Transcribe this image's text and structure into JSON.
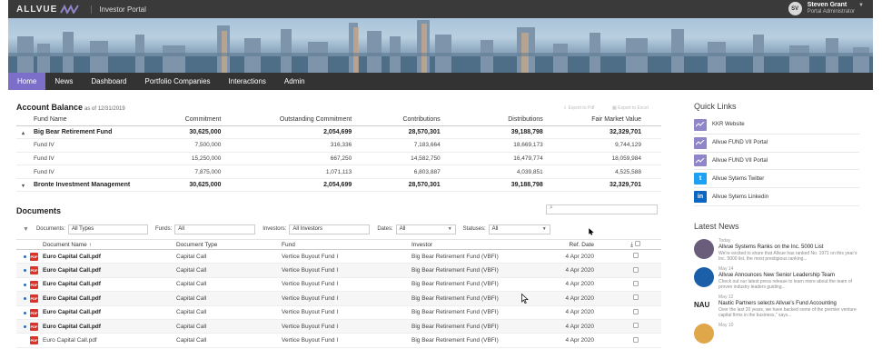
{
  "header": {
    "logo": "ALLVUE",
    "portal_title": "Investor Portal",
    "user_initials": "SV",
    "user_name": "Steven Grant",
    "user_role": "Portal Administrator"
  },
  "nav": [
    "Home",
    "News",
    "Dashboard",
    "Portfolio Companies",
    "Interactions",
    "Admin"
  ],
  "account_balance": {
    "title": "Account Balance",
    "as_of": "as of 12/31/2019",
    "export_pdf": "Export to Pdf",
    "export_excel": "Export to Excel",
    "columns": [
      "Fund Name",
      "Commitment",
      "Outstanding Commitment",
      "Contributions",
      "Distributions",
      "Fair Market Value"
    ],
    "rows": [
      {
        "type": "parent",
        "expander": "▴",
        "cells": [
          "Big Bear Retirement Fund",
          "30,625,000",
          "2,054,699",
          "28,570,301",
          "39,188,798",
          "32,329,701"
        ]
      },
      {
        "type": "child",
        "cells": [
          "Fund IV",
          "7,500,000",
          "316,336",
          "7,183,664",
          "18,669,173",
          "9,744,129"
        ]
      },
      {
        "type": "child",
        "cells": [
          "Fund IV",
          "15,250,000",
          "667,250",
          "14,582,750",
          "16,479,774",
          "18,059,984"
        ]
      },
      {
        "type": "child",
        "cells": [
          "Fund IV",
          "7,875,000",
          "1,071,113",
          "6,803,887",
          "4,039,851",
          "4,525,588"
        ]
      },
      {
        "type": "parent",
        "expander": "▾",
        "cells": [
          "Bronte Investment Management",
          "30,625,000",
          "2,054,699",
          "28,570,301",
          "39,188,798",
          "32,329,701"
        ]
      }
    ]
  },
  "documents": {
    "title": "Documents",
    "filters": {
      "documents_label": "Documents:",
      "documents_value": "All Types",
      "funds_label": "Funds:",
      "funds_value": "All",
      "investors_label": "Investors:",
      "investors_value": "All Investors",
      "dates_label": "Dates:",
      "dates_value": "All",
      "statuses_label": "Statuses:",
      "statuses_value": "All"
    },
    "columns": [
      "Document Name ↑",
      "Document Type",
      "Fund",
      "Investor",
      "Ref. Date"
    ],
    "rows": [
      {
        "unread": true,
        "cells": [
          "Euro Capital Call.pdf",
          "Capital Call",
          "Vertice Buyout Fund I",
          "Big Bear Retirement Fund (VBFI)",
          "4 Apr 2020"
        ]
      },
      {
        "unread": true,
        "cells": [
          "Euro Capital Call.pdf",
          "Capital Call",
          "Vertice Buyout Fund I",
          "Big Bear Retirement Fund (VBFI)",
          "4 Apr 2020"
        ]
      },
      {
        "unread": true,
        "cells": [
          "Euro Capital Call.pdf",
          "Capital Call",
          "Vertice Buyout Fund I",
          "Big Bear Retirement Fund (VBFI)",
          "4 Apr 2020"
        ]
      },
      {
        "unread": true,
        "cells": [
          "Euro Capital Call.pdf",
          "Capital Call",
          "Vertice Buyout Fund I",
          "Big Bear Retirement Fund (VBFI)",
          "4 Apr 2020"
        ]
      },
      {
        "unread": true,
        "cells": [
          "Euro Capital Call.pdf",
          "Capital Call",
          "Vertice Buyout Fund I",
          "Big Bear Retirement Fund (VBFI)",
          "4 Apr 2020"
        ]
      },
      {
        "unread": true,
        "cells": [
          "Euro Capital Call.pdf",
          "Capital Call",
          "Vertice Buyout Fund I",
          "Big Bear Retirement Fund (VBFI)",
          "4 Apr 2020"
        ]
      },
      {
        "unread": false,
        "cells": [
          "Euro Capital Call.pdf",
          "Capital Call",
          "Vertice Buyout Fund I",
          "Big Bear Retirement Fund (VBFI)",
          "4 Apr 2020"
        ]
      }
    ]
  },
  "quick_links": {
    "title": "Quick Links",
    "items": [
      {
        "label": "KKR Website",
        "icon": "chart-link-icon",
        "color": "#8e86c9"
      },
      {
        "label": "Allvue FUND VII Portal",
        "icon": "chart-link-icon",
        "color": "#8e86c9"
      },
      {
        "label": "Allvue FUND VII Portal",
        "icon": "chart-link-icon",
        "color": "#8e86c9"
      },
      {
        "label": "Allvue Sytems Twitter",
        "icon": "twitter-icon",
        "color": "#1da1f2"
      },
      {
        "label": "Allvue Sytems Linkedin",
        "icon": "linkedin-icon",
        "color": "#0a66c2"
      }
    ]
  },
  "latest_news": {
    "title": "Latest News",
    "items": [
      {
        "date": "Today",
        "title": "Allvue Systems Ranks on the Inc. 5000 List",
        "body": "We're excited to share that Allvue has ranked No. 1971 on this year's Inc. 5000 list, the most prestigious ranking..."
      },
      {
        "date": "May 14",
        "title": "Allvue Announces New Senior Leadership Team",
        "body": "Check out our latest press release to learn more about the team of proven industry leaders guiding..."
      },
      {
        "date": "May 12",
        "title": "Nautic Partners selects Allvue's Fund Accounting",
        "body": "Over the last 20 years, we have backed some of the premier venture capital firms in the business,\" says..."
      },
      {
        "date": "May 10",
        "title": "",
        "body": ""
      }
    ]
  },
  "colors": {
    "nav_active": "#7b6fc9",
    "topbar": "#3a3a3a",
    "nav": "#333333",
    "pdf": "#d9342b",
    "unread_dot": "#2c6db5"
  }
}
